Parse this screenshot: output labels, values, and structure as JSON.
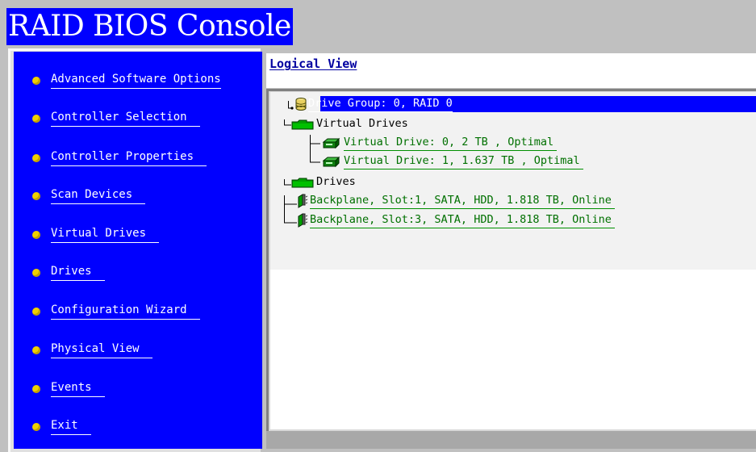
{
  "app": {
    "title": "RAID BIOS Console"
  },
  "menu": {
    "items": [
      {
        "label": "Advanced Software Options"
      },
      {
        "label": "Controller Selection"
      },
      {
        "label": "Controller Properties"
      },
      {
        "label": "Scan Devices"
      },
      {
        "label": "Virtual Drives"
      },
      {
        "label": "Drives"
      },
      {
        "label": "Configuration Wizard"
      },
      {
        "label": "Physical View"
      },
      {
        "label": "Events"
      },
      {
        "label": "Exit"
      }
    ]
  },
  "view": {
    "title": "Logical View"
  },
  "tree": {
    "drive_group": "Drive Group: 0, RAID 0",
    "virtual_drives_label": "Virtual Drives",
    "virtual_drives": [
      {
        "label": "Virtual Drive: 0, 2 TB , Optimal"
      },
      {
        "label": "Virtual Drive: 1, 1.637 TB , Optimal"
      }
    ],
    "drives_label": "Drives",
    "drives": [
      {
        "label": "Backplane, Slot:1, SATA, HDD, 1.818 TB, Online"
      },
      {
        "label": "Backplane, Slot:3, SATA, HDD, 1.818 TB, Online"
      }
    ]
  },
  "colors": {
    "menu_background": "#0000ff",
    "bullet": "#f0d000",
    "link_green": "#007000",
    "selection": "#0000ff",
    "title_background": "#0000ff"
  },
  "icons": {
    "bullet": "menu-bullet-icon",
    "drive_group": "disk-stack-icon",
    "folder": "folder-icon",
    "virtual_drive": "virtual-drive-icon",
    "physical_drive": "physical-drive-icon"
  }
}
